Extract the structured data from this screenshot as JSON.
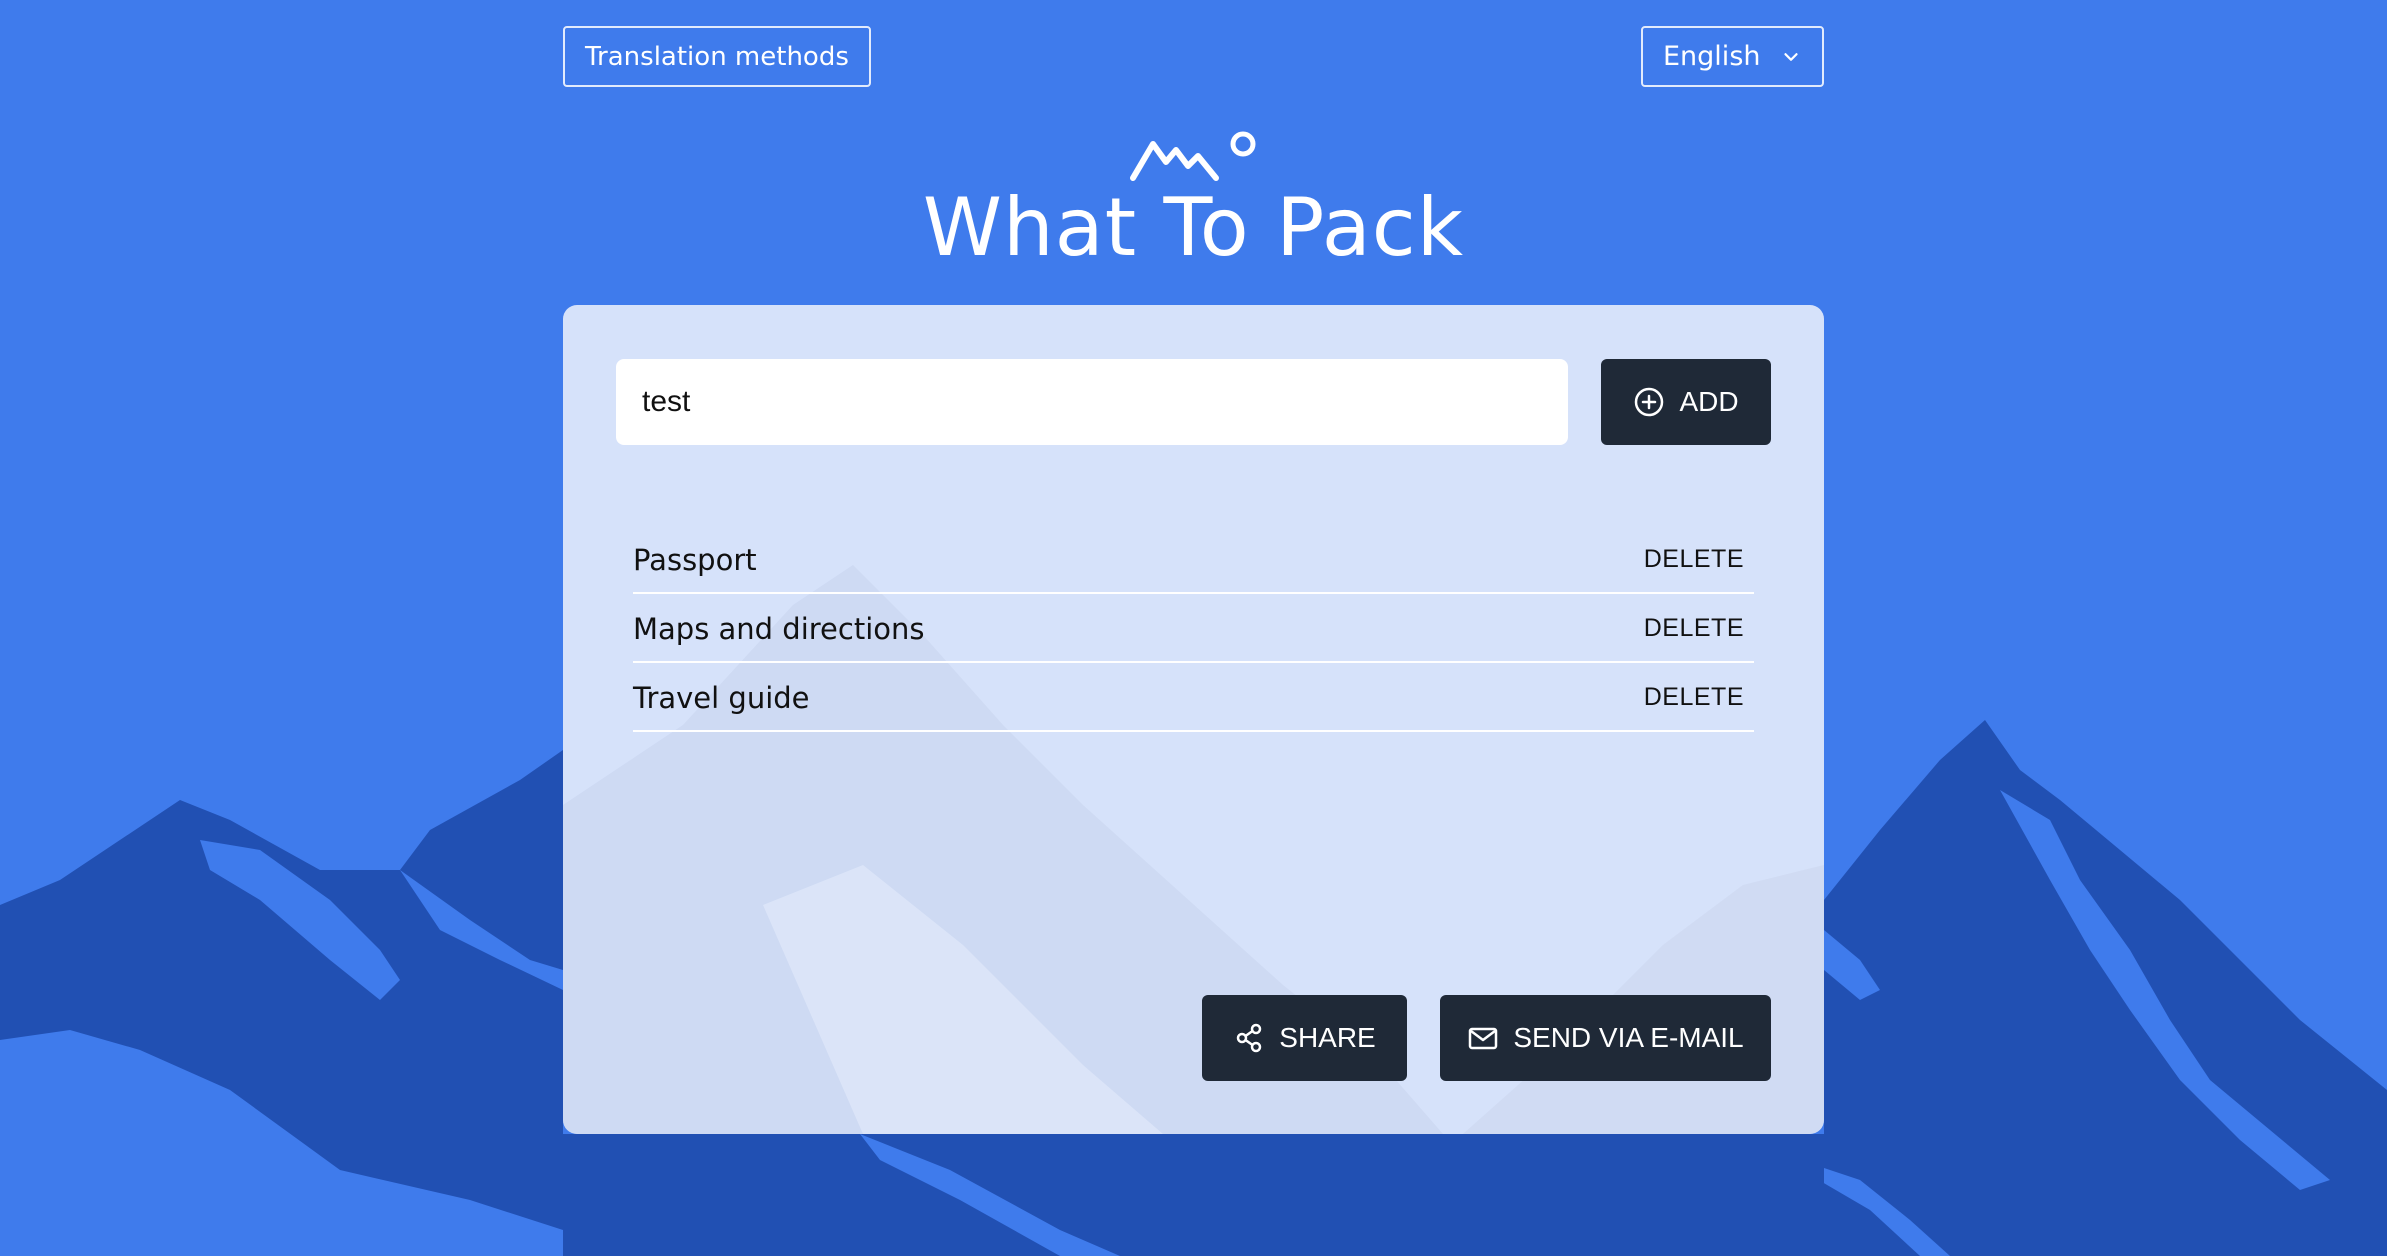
{
  "header": {
    "translation_button_label": "Translation methods",
    "language_selected": "English"
  },
  "app": {
    "title": "What To Pack"
  },
  "form": {
    "input_value": "test",
    "add_label": "ADD"
  },
  "items": [
    {
      "name": "Passport",
      "delete_label": "DELETE"
    },
    {
      "name": "Maps and directions",
      "delete_label": "DELETE"
    },
    {
      "name": "Travel guide",
      "delete_label": "DELETE"
    }
  ],
  "actions": {
    "share_label": "SHARE",
    "email_label": "SEND VIA E-MAIL"
  },
  "icons": {
    "logo": "mountain-sun-logo",
    "dropdown": "chevron-down-icon",
    "add": "plus-circle-icon",
    "share": "share-icon",
    "email": "mail-icon"
  },
  "colors": {
    "background": "#3f7bec",
    "mountains": "#2150b3",
    "card": "#dbe5fa",
    "button": "#1f2937"
  }
}
